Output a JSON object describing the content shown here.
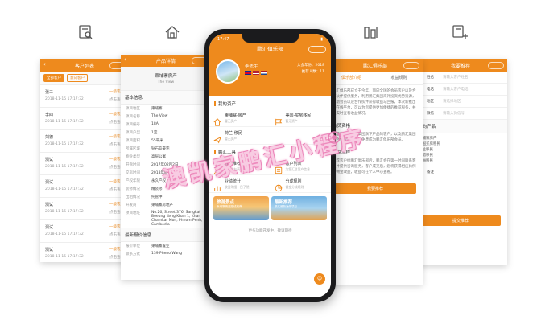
{
  "top_icons": [
    "search-doc-icon",
    "home-icon",
    "columns-icon",
    "add-user-icon"
  ],
  "customer_list": {
    "title": "客户列表",
    "chips": [
      "全部客户",
      "意向客户"
    ],
    "rows": [
      {
        "name": "张三",
        "date": "2018-11-15 17:17:32",
        "status": "一级客户",
        "status2": "点击查看"
      },
      {
        "name": "李四",
        "date": "2018-11-15 17:17:32",
        "status": "一级客户",
        "status2": "点击查看"
      },
      {
        "name": "刘德",
        "date": "2018-11-15 17:17:32",
        "status": "一级客户",
        "status2": "点击查看"
      },
      {
        "name": "测试",
        "date": "2018-11-15 17:17:32",
        "status": "一级客户",
        "status2": "点击查看"
      },
      {
        "name": "测试",
        "date": "2018-11-15 17:17:32",
        "status": "一级客户",
        "status2": "点击查看"
      },
      {
        "name": "测试",
        "date": "2018-11-15 17:17:32",
        "status": "一级客户",
        "status2": "点击查看"
      },
      {
        "name": "测试",
        "date": "2018-11-15 17:17:32",
        "status": "一级客户",
        "status2": "点击查看"
      },
      {
        "name": "测试",
        "date": "2018-11-15 17:17:32",
        "status": "一级客户",
        "status2": "点击查看"
      }
    ]
  },
  "product_detail": {
    "title": "产品详情",
    "header_name": "柬埔寨房产",
    "header_sub": "The View",
    "basic_title": "基本信息",
    "fields": [
      {
        "k": "项目地区",
        "v": "柬埔寨"
      },
      {
        "k": "项目名称",
        "v": "The View"
      },
      {
        "k": "项目编号",
        "v": "18A"
      },
      {
        "k": "项目户型",
        "v": "1室"
      },
      {
        "k": "项目面积",
        "v": "55平米"
      },
      {
        "k": "所属区域",
        "v": "钻石岛豪宅"
      },
      {
        "k": "物业类型",
        "v": "高层公寓"
      },
      {
        "k": "开盘时间",
        "v": "2017年02月2日"
      },
      {
        "k": "交房时间",
        "v": "2018年8月2日"
      },
      {
        "k": "产权年限",
        "v": "永久产权"
      },
      {
        "k": "装修情况",
        "v": "精装修"
      },
      {
        "k": "出租情况",
        "v": "托管中"
      },
      {
        "k": "开发商",
        "v": "柬埔寨房地产"
      },
      {
        "k": "项目地址",
        "v": "No.26, Street 376, Sangkat Boeung Keng Khan 1, Khan Chamkar Mon, Phnom Penh, Cambodia"
      }
    ],
    "latest_title": "最新报价信息",
    "latest": [
      {
        "k": "报价单位",
        "v": "柬埔寨置业"
      },
      {
        "k": "联系方式",
        "v": "139 Pheno Wang"
      }
    ]
  },
  "phone": {
    "time": "17:47",
    "club_title": "鹏汇俱乐部",
    "user_name": "李先生",
    "stats": [
      "入会年份：2018",
      "推荐人数：11"
    ],
    "section_my": "我的资产",
    "my_assets": [
      {
        "title": "柬埔寨-房产",
        "sub": "暂无资产",
        "icon": "house-icon"
      },
      {
        "title": "美国-买房移民",
        "sub": "暂无资产",
        "icon": "flag-icon"
      },
      {
        "title": "荷兰-移民",
        "sub": "暂无资产",
        "icon": "plane-icon"
      },
      {
        "title": "",
        "sub": "",
        "icon": ""
      }
    ],
    "section_tools": "鹏汇工具",
    "tools": [
      {
        "title": "我要推荐",
        "sub": "推荐朋友获取佣金",
        "icon": "recommend-icon"
      },
      {
        "title": "客户列表",
        "sub": "为您汇总客户信息",
        "icon": "clients-icon"
      },
      {
        "title": "业绩统计",
        "sub": "收益明细一目了然",
        "icon": "stats-icon"
      },
      {
        "title": "分成规则",
        "sub": "佣金分成规则",
        "icon": "rules-icon"
      }
    ],
    "banners": [
      {
        "title": "旅游景点",
        "sub": "柬埔寨精选路线推荐"
      },
      {
        "title": "最新推荐",
        "sub": "鹏汇最新海外项目"
      }
    ],
    "footer": "更多功能开发中，敬请期待"
  },
  "club_intro": {
    "title": "鹏汇俱乐部",
    "tabs": [
      "俱乐部介绍",
      "收益规则"
    ],
    "intro": "鹏汇俱乐部成立于今年，面向全国的会员客户以及合作伙伴提供服务，利用鹏汇集团海外投资优势资源，帮助会员以及合作伙伴获得收益与回报，本次新推出的在线平台，可以为您提供更加便捷的推荐服务，并且实时查看收益情况。",
    "section1": "会员资格",
    "para1": "凡是购买过鹏汇集团旗下产品的客户，以及鹏汇集团的合作伙伴均可以免费成为鹏汇俱乐部会员。",
    "section2": "收益流程",
    "para2": "推荐客户给鹏汇俱乐部后，鹏汇会在第一时间联系客户并提供咨询服务，客户成交后，您将获得相应比例的佣金收益，收益可在个人中心查看。",
    "button": "我要推荐"
  },
  "referral": {
    "title": "我要推荐",
    "fields": [
      {
        "label": "姓名",
        "ph": "请输入客户姓名"
      },
      {
        "label": "电话",
        "ph": "请输入客户电话"
      },
      {
        "label": "地区",
        "ph": "请选择地区"
      },
      {
        "label": "微信",
        "ph": "请输入微信号"
      }
    ],
    "interest_title": "意向产品",
    "interests": [
      "柬埔寨房产",
      "美国买房移民",
      "荷兰移民",
      "希腊移民",
      "澳洲移民"
    ],
    "note_label": "备注",
    "button": "提交推荐"
  },
  "watermark": "澳凯家鹏汇小程序",
  "colors": {
    "accent": "#ee8a1d",
    "watermark": "#e77bb2"
  }
}
